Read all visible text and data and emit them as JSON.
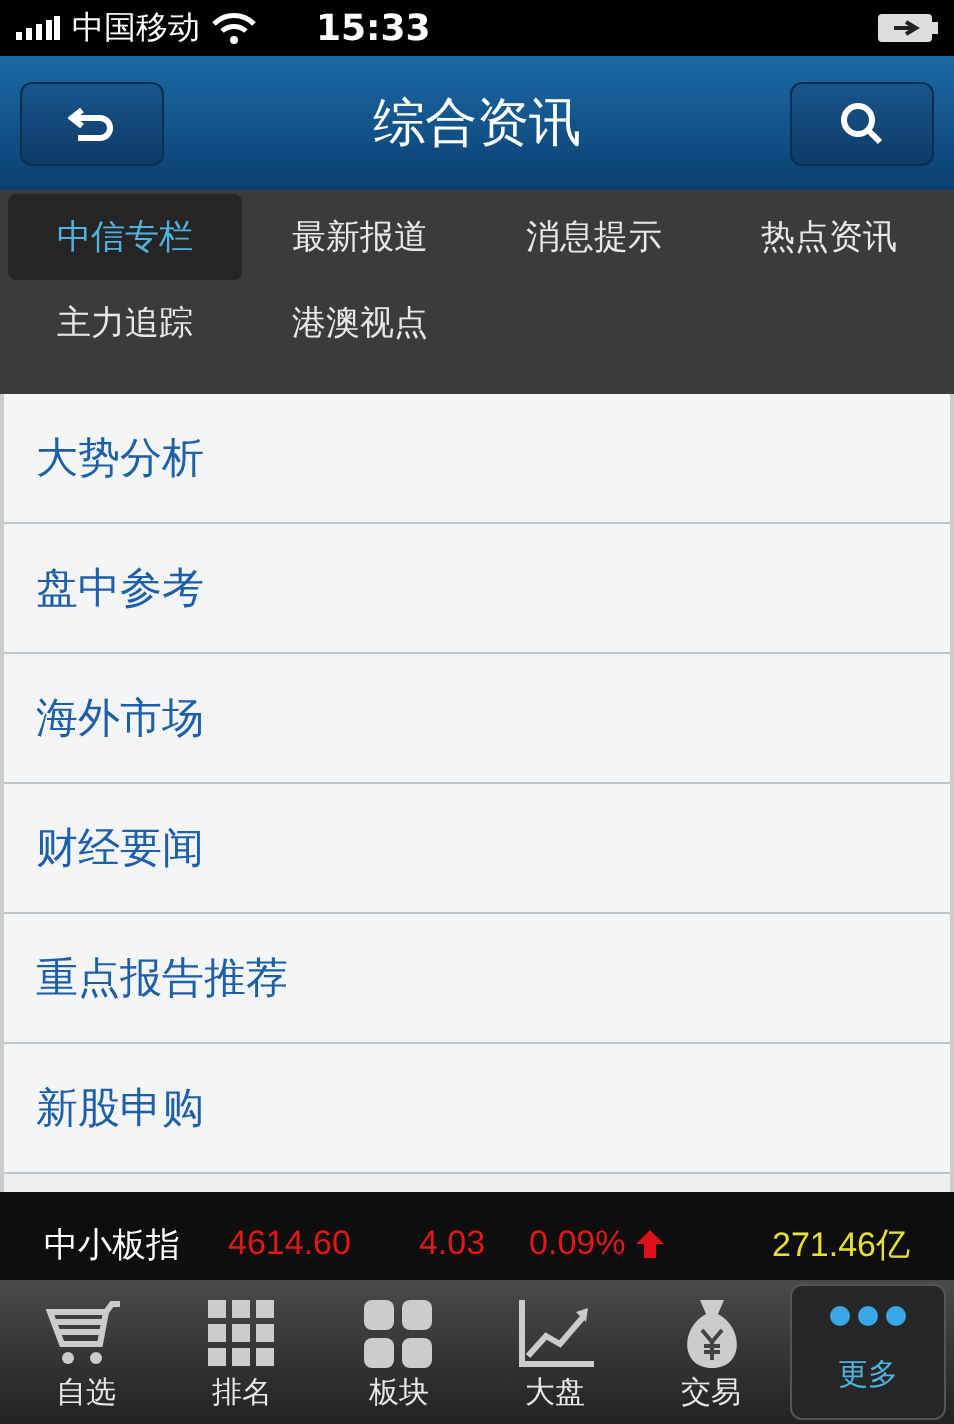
{
  "status_bar": {
    "carrier": "中国移动",
    "time": "15:33"
  },
  "header": {
    "title": "综合资讯"
  },
  "tabs": [
    {
      "label": "中信专栏",
      "selected": true
    },
    {
      "label": "最新报道",
      "selected": false
    },
    {
      "label": "消息提示",
      "selected": false
    },
    {
      "label": "热点资讯",
      "selected": false
    },
    {
      "label": "主力追踪",
      "selected": false
    },
    {
      "label": "港澳视点",
      "selected": false
    }
  ],
  "list": [
    "大势分析",
    "盘中参考",
    "海外市场",
    "财经要闻",
    "重点报告推荐",
    "新股申购"
  ],
  "ticker": {
    "name": "中小板指",
    "price": "4614.60",
    "change": "4.03",
    "percent": "0.09%",
    "rising": true,
    "turnover": "271.46亿"
  },
  "tab_bar": [
    {
      "label": "自选",
      "kind": "cart",
      "selected": false
    },
    {
      "label": "排名",
      "kind": "ranking",
      "selected": false
    },
    {
      "label": "板块",
      "kind": "blocks",
      "selected": false
    },
    {
      "label": "大盘",
      "kind": "chart",
      "selected": false
    },
    {
      "label": "交易",
      "kind": "moneybag",
      "selected": false
    },
    {
      "label": "更多",
      "kind": "more",
      "selected": true
    }
  ]
}
